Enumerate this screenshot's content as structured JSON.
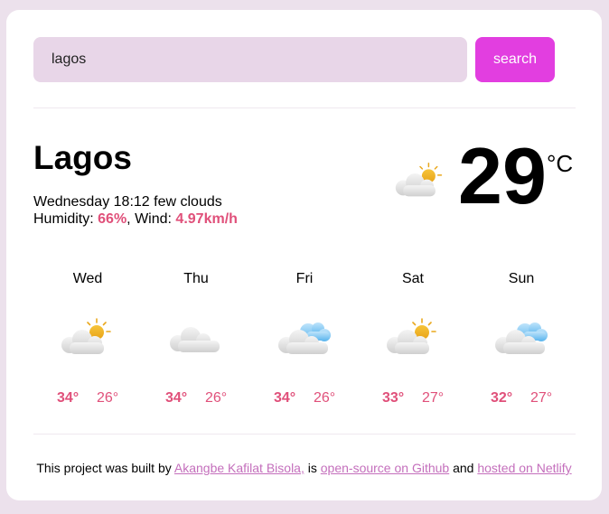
{
  "search": {
    "value": "lagos",
    "button_label": "search"
  },
  "current": {
    "city": "Lagos",
    "day_time": "Wednesday 18:12",
    "condition": "few clouds",
    "humidity_label": "Humidity:",
    "humidity": "66%",
    "wind_label": "Wind:",
    "wind": "4.97km/h",
    "temperature": "29",
    "unit": "°C",
    "icon": "sun-behind-cloud-icon"
  },
  "forecast": [
    {
      "day": "Wed",
      "high": "34°",
      "low": "26°",
      "icon": "sun-behind-cloud-icon"
    },
    {
      "day": "Thu",
      "high": "34°",
      "low": "26°",
      "icon": "cloud-icon"
    },
    {
      "day": "Fri",
      "high": "34°",
      "low": "26°",
      "icon": "clouds-icon"
    },
    {
      "day": "Sat",
      "high": "33°",
      "low": "27°",
      "icon": "sun-behind-cloud-icon"
    },
    {
      "day": "Sun",
      "high": "32°",
      "low": "27°",
      "icon": "clouds-icon"
    }
  ],
  "footer": {
    "prefix": "This project was built by",
    "author_link": "Akangbe Kafilat Bisola,",
    "middle": "is",
    "github_link": "open-source on Github",
    "connector": "and",
    "netlify_link": "hosted on Netlify"
  },
  "colors": {
    "accent_button": "#e23ee0",
    "input_background": "#e8d6e8",
    "highlight_text": "#e0507a",
    "link": "#c46fbc",
    "page_background": "#ece1ec"
  }
}
